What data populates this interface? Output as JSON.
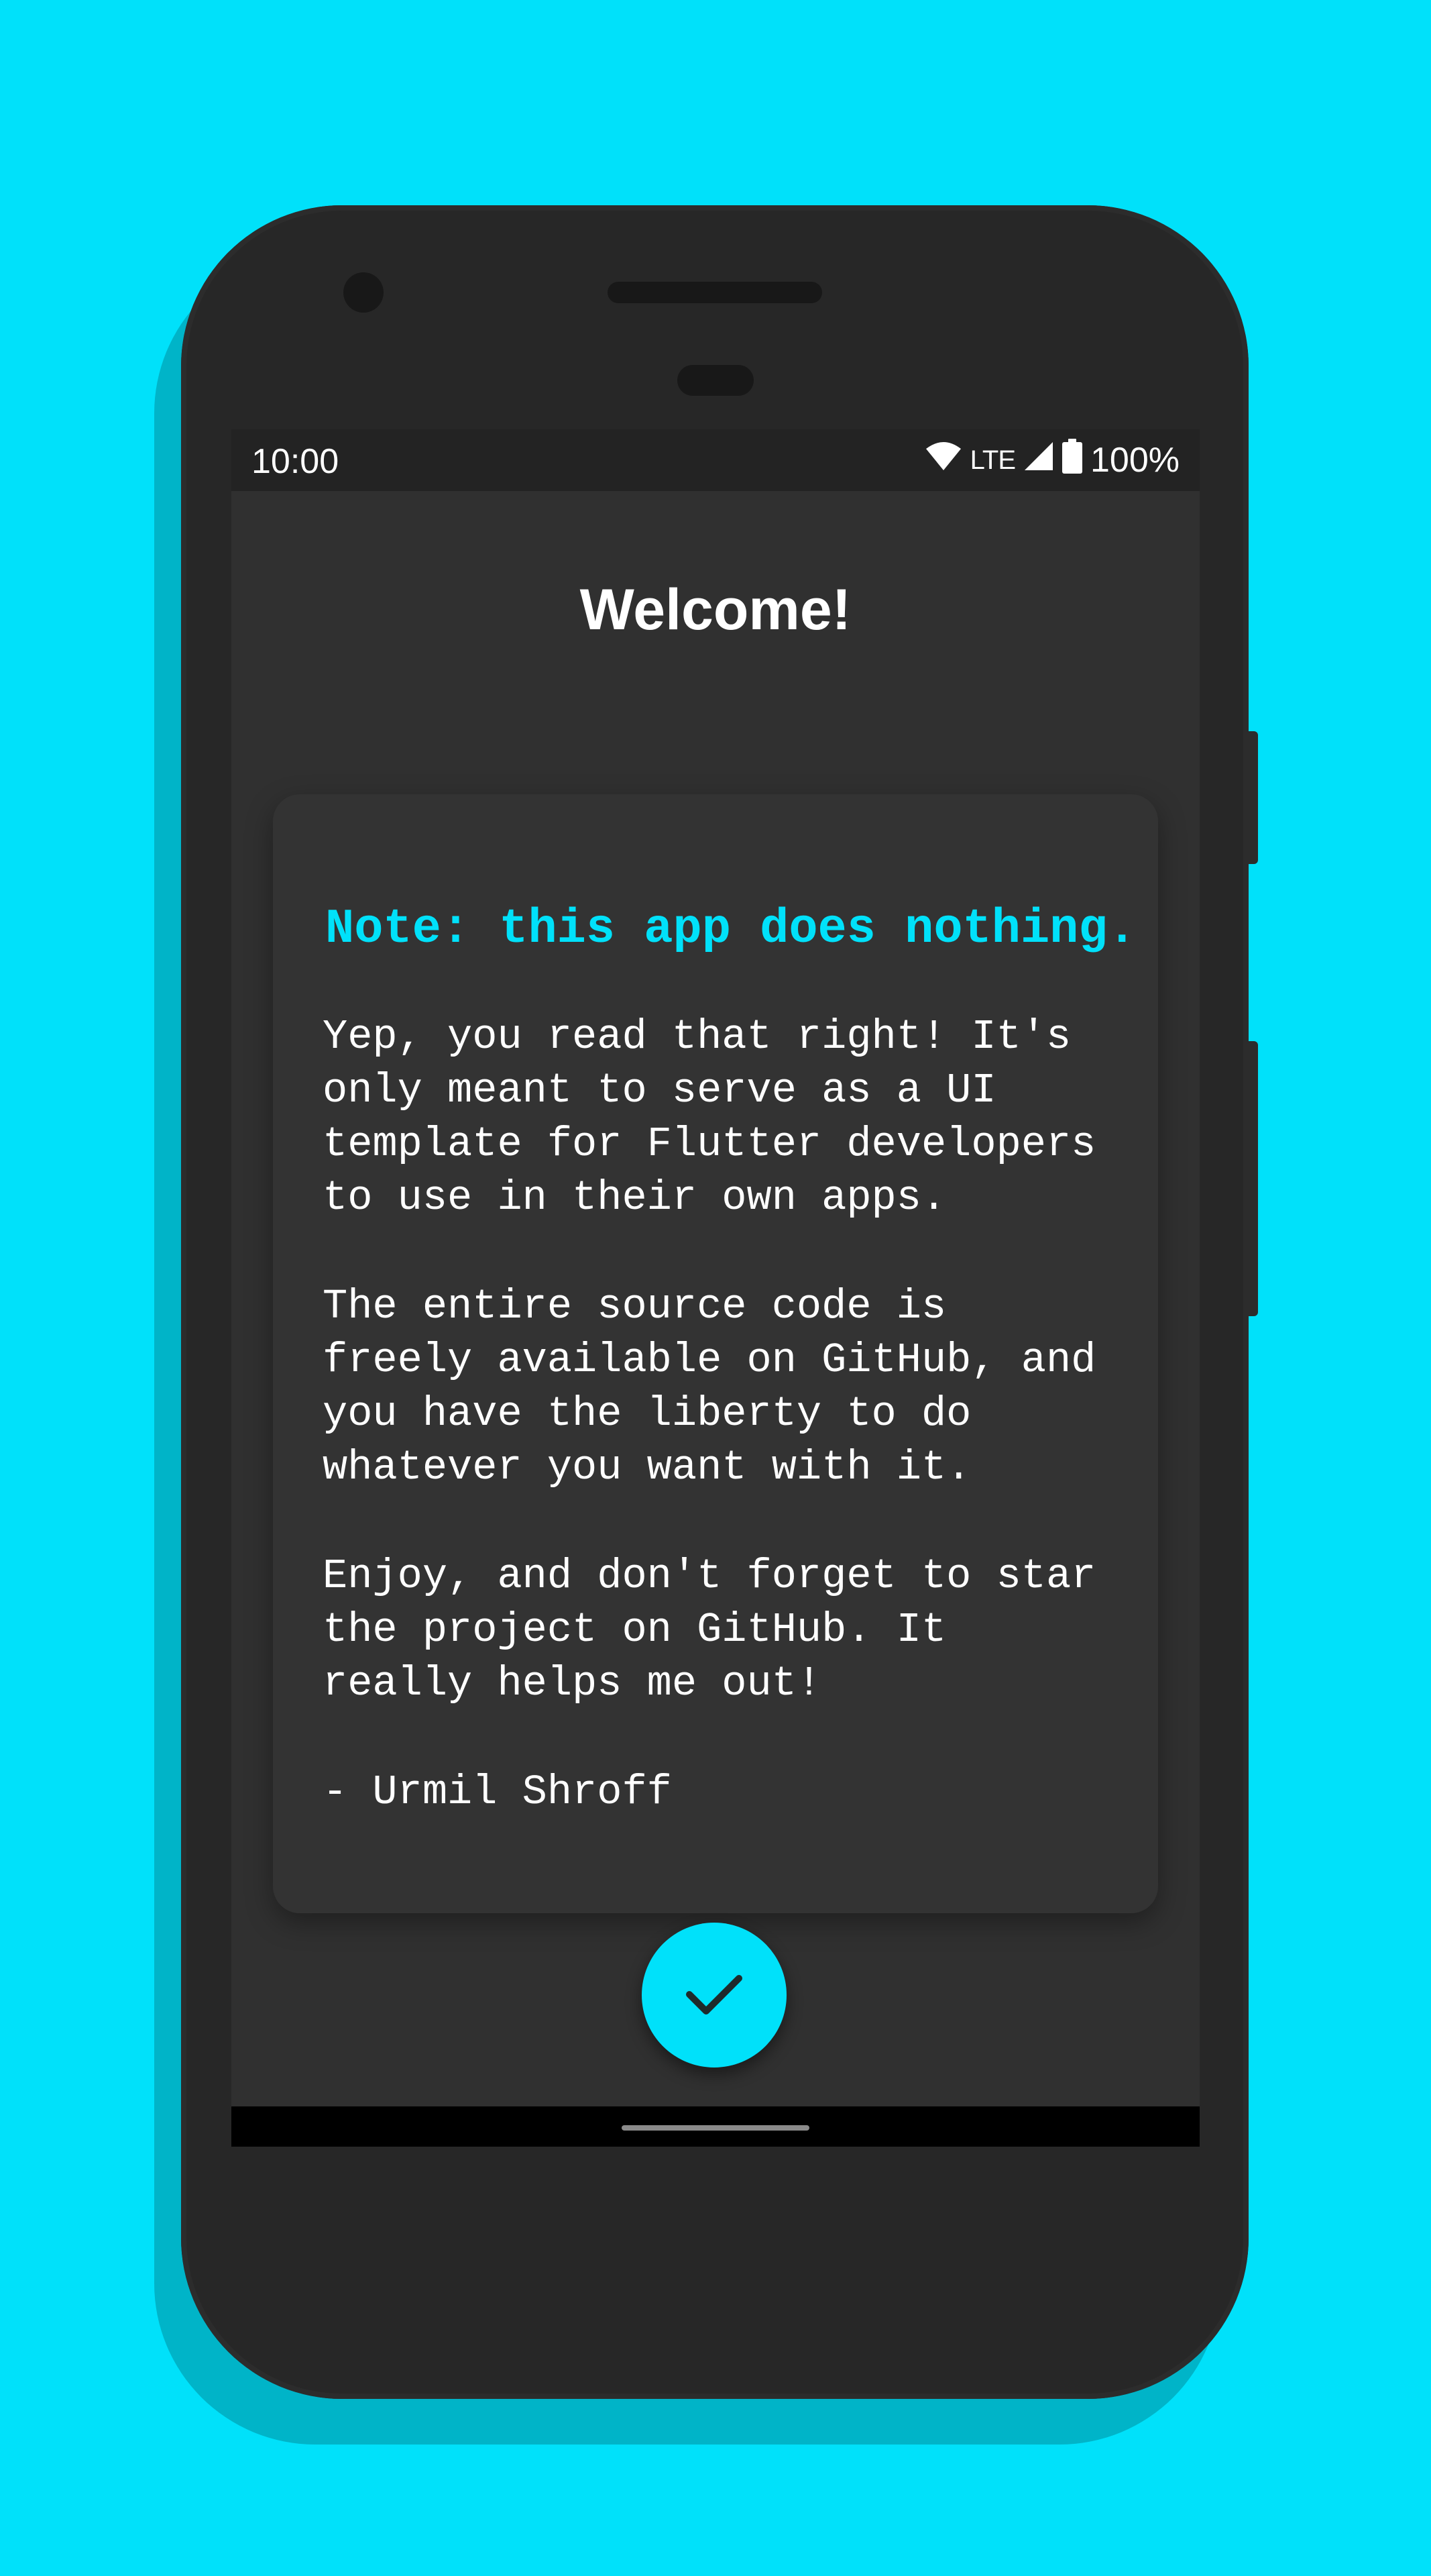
{
  "status_bar": {
    "time": "10:00",
    "network": "LTE",
    "battery": "100%"
  },
  "welcome": {
    "title": "Welcome!",
    "note": "Note: this app does nothing.",
    "paragraphs": [
      "Yep, you read that right! It's\nonly meant to serve as a UI\ntemplate for Flutter developers\nto use in their own apps.",
      "The entire source code is\nfreely available on GitHub, and\nyou have the liberty to do\nwhatever you want with it.",
      "Enjoy, and don't forget to star\nthe project on GitHub. It\nreally helps me out!",
      "- Urmil Shroff"
    ]
  },
  "colors": {
    "background": "#00e1fa",
    "accent": "#00e1fa",
    "card": "#333333",
    "screen": "#303030"
  },
  "icons": {
    "fab": "check-icon",
    "wifi": "wifi-icon",
    "signal": "signal-icon",
    "battery": "battery-icon"
  }
}
